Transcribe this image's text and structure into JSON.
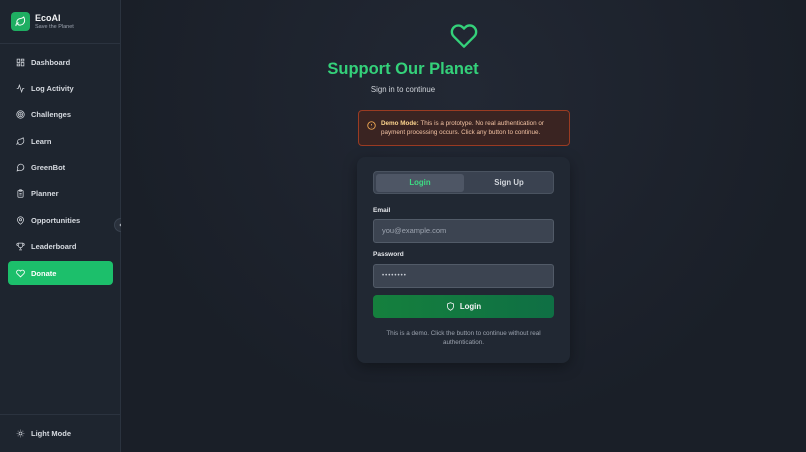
{
  "brand": {
    "name": "EcoAI",
    "tagline": "Save the Planet"
  },
  "nav": [
    {
      "label": "Dashboard",
      "icon": "grid-icon"
    },
    {
      "label": "Log Activity",
      "icon": "activity-icon"
    },
    {
      "label": "Challenges",
      "icon": "target-icon"
    },
    {
      "label": "Learn",
      "icon": "leaf-icon"
    },
    {
      "label": "GreenBot",
      "icon": "chat-icon"
    },
    {
      "label": "Planner",
      "icon": "clipboard-icon"
    },
    {
      "label": "Opportunities",
      "icon": "map-pin-icon"
    },
    {
      "label": "Leaderboard",
      "icon": "trophy-icon"
    },
    {
      "label": "Donate",
      "icon": "heart-icon",
      "active": true
    }
  ],
  "sidebar_footer": {
    "label": "Light Mode"
  },
  "page": {
    "title": "Support Our Planet",
    "subtitle": "Sign in to continue"
  },
  "demo_notice": {
    "bold": "Demo Mode:",
    "text": "This is a prototype. No real authentication or payment processing occurs. Click any button to continue."
  },
  "auth": {
    "tabs": {
      "login": "Login",
      "signup": "Sign Up"
    },
    "email_label": "Email",
    "email_placeholder": "you@example.com",
    "password_label": "Password",
    "password_value": "••••••••",
    "submit_label": "Login",
    "note": "This is a demo. Click the button to continue without real authentication."
  },
  "colors": {
    "accent": "#1cbf6b",
    "title": "#34d17a",
    "warning_border": "#9a3b22"
  }
}
